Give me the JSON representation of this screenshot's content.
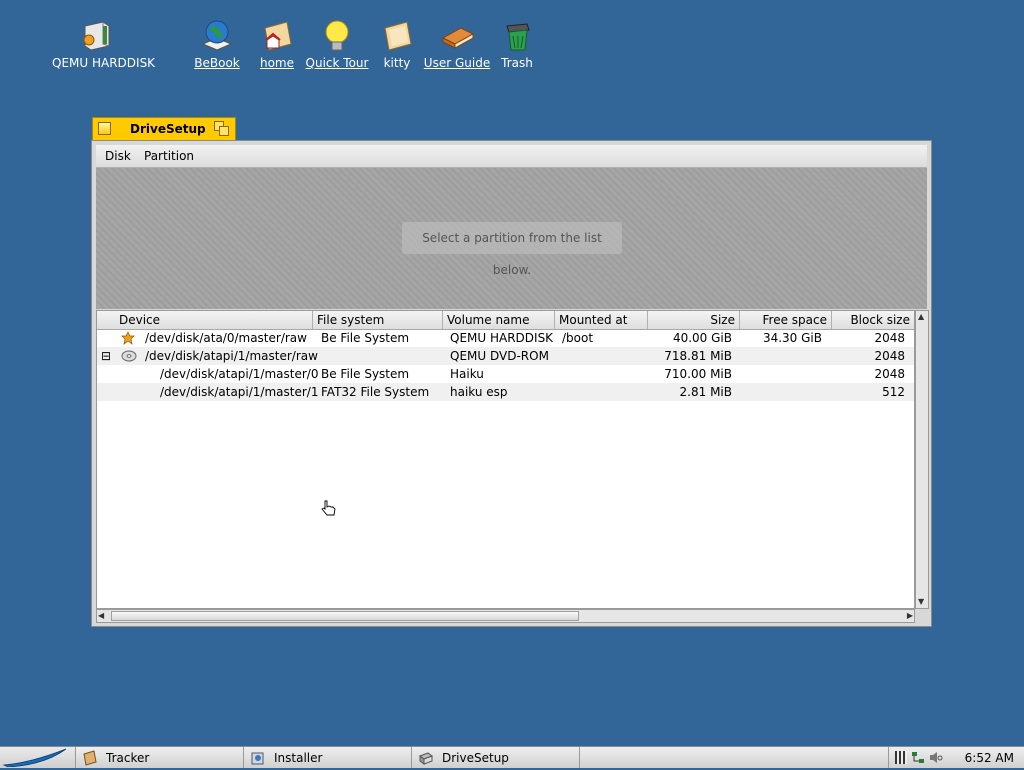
{
  "desktop": {
    "icons": [
      {
        "label": "QEMU HARDDISK"
      },
      {
        "label": "BeBook"
      },
      {
        "label": "home"
      },
      {
        "label": "Quick Tour"
      },
      {
        "label": "kitty"
      },
      {
        "label": "User Guide"
      },
      {
        "label": "Trash"
      }
    ]
  },
  "window": {
    "title": "DriveSetup",
    "menu": [
      "Disk",
      "Partition"
    ],
    "diskmap_message": "Select a partition from the list below.",
    "columns": [
      "Device",
      "File system",
      "Volume name",
      "Mounted at",
      "Size",
      "Free space",
      "Block size"
    ],
    "rows": [
      {
        "device": "/dev/disk/ata/0/master/raw",
        "fs": "Be File System",
        "volume": "QEMU HARDDISK",
        "mount": "/boot",
        "size": "40.00 GiB",
        "free": "34.30 GiB",
        "block": "2048"
      },
      {
        "device": "/dev/disk/atapi/1/master/raw",
        "fs": "",
        "volume": "QEMU DVD-ROM",
        "mount": "",
        "size": "718.81 MiB",
        "free": "",
        "block": "2048"
      },
      {
        "device": "/dev/disk/atapi/1/master/0",
        "fs": "Be File System",
        "volume": "Haiku",
        "mount": "",
        "size": "710.00 MiB",
        "free": "",
        "block": "2048"
      },
      {
        "device": "/dev/disk/atapi/1/master/1",
        "fs": "FAT32 File System",
        "volume": "haiku esp",
        "mount": "",
        "size": "2.81 MiB",
        "free": "",
        "block": "512"
      }
    ],
    "expander": "⊟"
  },
  "taskbar": {
    "items": [
      "Tracker",
      "Installer",
      "DriveSetup"
    ],
    "clock": "6:52 AM"
  },
  "colors": {
    "desktop": "#336698",
    "tab": "#ffcb00"
  }
}
